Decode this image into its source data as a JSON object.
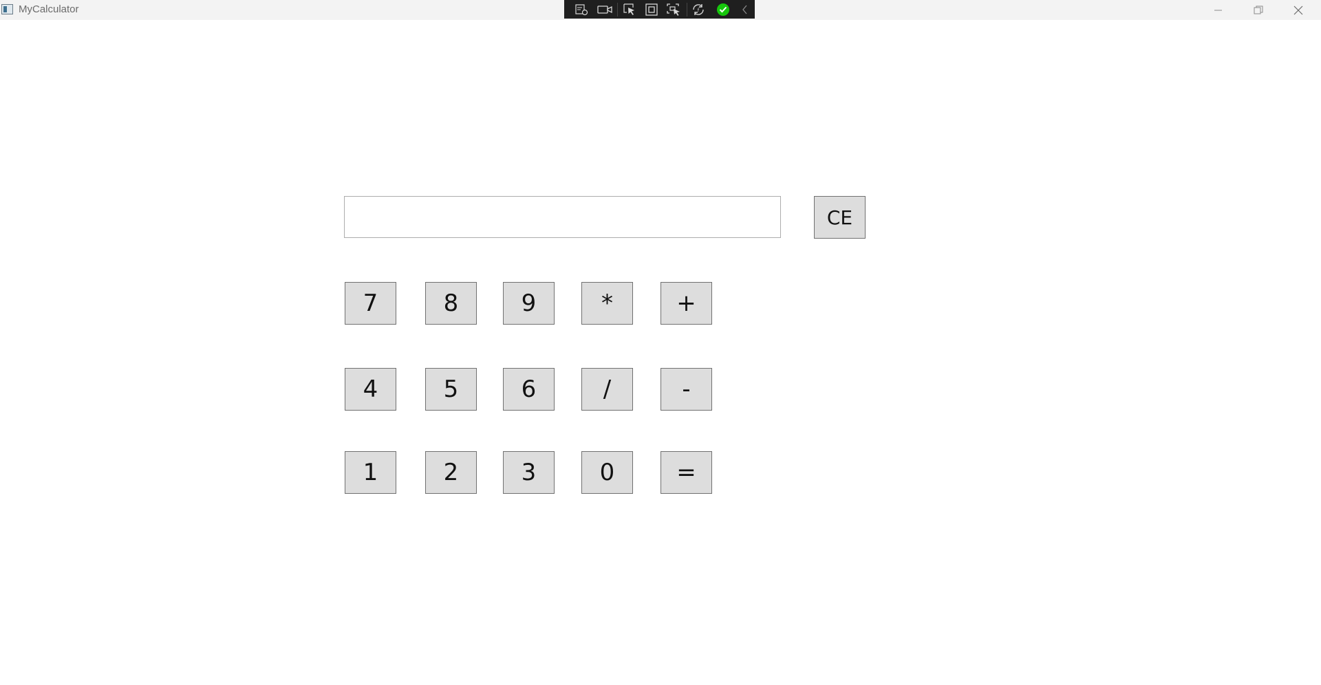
{
  "window": {
    "title": "MyCalculator"
  },
  "debug_toolbar": {
    "icons": [
      "live-visual-tree-icon",
      "record-icon",
      "select-element-icon",
      "display-layout-adorners-icon",
      "track-focused-element-icon",
      "hot-reload-icon",
      "binding-success-icon",
      "collapse-toolbar-icon"
    ],
    "accent_color": "#16c60c"
  },
  "display": {
    "value": "",
    "placeholder": ""
  },
  "buttons": {
    "clear": "CE",
    "row1": [
      "7",
      "8",
      "9",
      "*",
      "+"
    ],
    "row2": [
      "4",
      "5",
      "6",
      "/",
      "-"
    ],
    "row3": [
      "1",
      "2",
      "3",
      "0",
      "="
    ]
  },
  "colors": {
    "button_face": "#dddddd",
    "button_border": "#707070",
    "titlebar": "#f3f3f3",
    "debug_toolbar": "#1f1f1f"
  }
}
